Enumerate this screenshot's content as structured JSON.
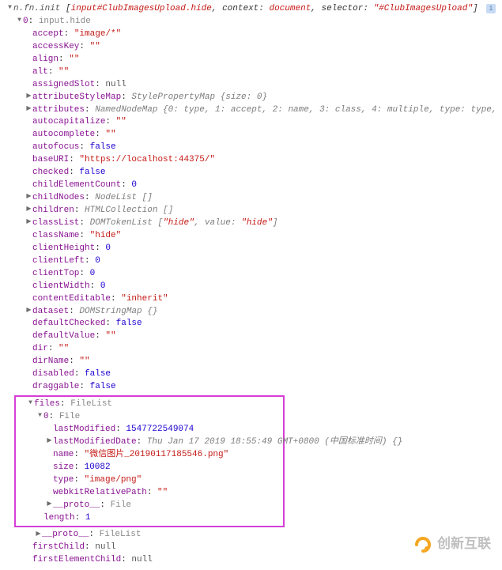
{
  "header": {
    "prefix": "n.fn.init ",
    "bracket_open": "[",
    "el": "input#ClubImagesUpload.hide",
    "context_k": "context",
    "context_v": "document",
    "selector_k": "selector",
    "selector_v": "\"#ClubImagesUpload\"",
    "bracket_close": "]"
  },
  "root0": {
    "label": "0",
    "value": "input.hide"
  },
  "props": {
    "accept": {
      "k": "accept",
      "v": "\"image/*\"",
      "cls": "k-red"
    },
    "accessKey": {
      "k": "accessKey",
      "v": "\"\"",
      "cls": "k-red"
    },
    "align": {
      "k": "align",
      "v": "\"\"",
      "cls": "k-red"
    },
    "alt": {
      "k": "alt",
      "v": "\"\"",
      "cls": "k-red"
    },
    "assignedSlot": {
      "k": "assignedSlot",
      "v": "null",
      "cls": "k-gray"
    },
    "attributeStyleMap": {
      "k": "attributeStyleMap",
      "preview": "StylePropertyMap {size: 0}",
      "expandable": true
    },
    "attributes": {
      "k": "attributes",
      "preview": "NamedNodeMap {0: type, 1: accept, 2: name, 3: class, 4: multiple, type: type,",
      "expandable": true
    },
    "autocapitalize": {
      "k": "autocapitalize",
      "v": "\"\"",
      "cls": "k-red"
    },
    "autocomplete": {
      "k": "autocomplete",
      "v": "\"\"",
      "cls": "k-red"
    },
    "autofocus": {
      "k": "autofocus",
      "v": "false",
      "cls": "k-blue"
    },
    "baseURI": {
      "k": "baseURI",
      "v": "\"https://localhost:44375/\"",
      "cls": "k-red"
    },
    "checked": {
      "k": "checked",
      "v": "false",
      "cls": "k-blue"
    },
    "childElementCount": {
      "k": "childElementCount",
      "v": "0",
      "cls": "k-blue"
    },
    "childNodes": {
      "k": "childNodes",
      "preview": "NodeList []",
      "expandable": true
    },
    "children": {
      "k": "children",
      "preview": "HTMLCollection []",
      "expandable": true
    },
    "classList": {
      "k": "classList",
      "preview_parts": {
        "type": "DOMTokenList ",
        "open": "[",
        "str": "\"hide\"",
        "mid": ", value: ",
        "str2": "\"hide\"",
        "close": "]"
      },
      "expandable": true
    },
    "className": {
      "k": "className",
      "v": "\"hide\"",
      "cls": "k-red"
    },
    "clientHeight": {
      "k": "clientHeight",
      "v": "0",
      "cls": "k-blue"
    },
    "clientLeft": {
      "k": "clientLeft",
      "v": "0",
      "cls": "k-blue"
    },
    "clientTop": {
      "k": "clientTop",
      "v": "0",
      "cls": "k-blue"
    },
    "clientWidth": {
      "k": "clientWidth",
      "v": "0",
      "cls": "k-blue"
    },
    "contentEditable": {
      "k": "contentEditable",
      "v": "\"inherit\"",
      "cls": "k-red"
    },
    "dataset": {
      "k": "dataset",
      "preview": "DOMStringMap {}",
      "expandable": true
    },
    "defaultChecked": {
      "k": "defaultChecked",
      "v": "false",
      "cls": "k-blue"
    },
    "defaultValue": {
      "k": "defaultValue",
      "v": "\"\"",
      "cls": "k-red"
    },
    "dir": {
      "k": "dir",
      "v": "\"\"",
      "cls": "k-red"
    },
    "dirName": {
      "k": "dirName",
      "v": "\"\"",
      "cls": "k-red"
    },
    "disabled": {
      "k": "disabled",
      "v": "false",
      "cls": "k-blue"
    },
    "draggable": {
      "k": "draggable",
      "v": "false",
      "cls": "k-blue"
    }
  },
  "files": {
    "k": "files",
    "type": "FileList",
    "item0": {
      "label": "0",
      "type": "File",
      "lastModified": {
        "k": "lastModified",
        "v": "1547722549074",
        "cls": "k-blue"
      },
      "lastModifiedDate": {
        "k": "lastModifiedDate",
        "preview": "Thu Jan 17 2019 18:55:49 GMT+0800 (中国标准时间) {}",
        "expandable": true
      },
      "name": {
        "k": "name",
        "v": "\"微信图片_20190117185546.png\"",
        "cls": "k-red"
      },
      "size": {
        "k": "size",
        "v": "10082",
        "cls": "k-blue"
      },
      "typeP": {
        "k": "type",
        "v": "\"image/png\"",
        "cls": "k-red"
      },
      "webkitRelativePath": {
        "k": "webkitRelativePath",
        "v": "\"\"",
        "cls": "k-red"
      },
      "proto": {
        "k": "__proto__",
        "preview": "File",
        "expandable": true
      }
    },
    "length": {
      "k": "length",
      "v": "1",
      "cls": "k-blue"
    },
    "proto": {
      "k": "__proto__",
      "preview": "FileList",
      "expandable": true
    }
  },
  "tail": {
    "firstChild": {
      "k": "firstChild",
      "v": "null",
      "cls": "k-gray"
    },
    "firstElementChild": {
      "k": "firstElementChild",
      "v": "null",
      "cls": "k-gray"
    }
  },
  "watermark": "创新互联"
}
